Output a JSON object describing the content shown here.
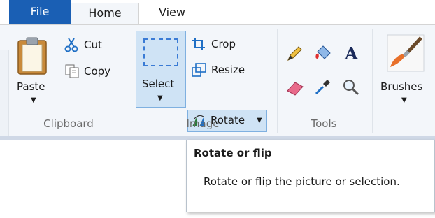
{
  "tabs": {
    "file": "File",
    "home": "Home",
    "view": "View"
  },
  "clipboard": {
    "group_label": "Clipboard",
    "paste": "Paste",
    "cut": "Cut",
    "copy": "Copy"
  },
  "image": {
    "group_label": "Image",
    "select": "Select",
    "crop": "Crop",
    "resize": "Resize",
    "rotate": "Rotate"
  },
  "tools": {
    "group_label": "Tools"
  },
  "brushes": {
    "label": "Brushes"
  },
  "tooltip": {
    "title": "Rotate or flip",
    "body": "Rotate or flip the picture or selection."
  },
  "colors": {
    "file_tab": "#1a5fb4",
    "selected_bg": "#cfe3f5",
    "selected_border": "#7fb0e0"
  }
}
